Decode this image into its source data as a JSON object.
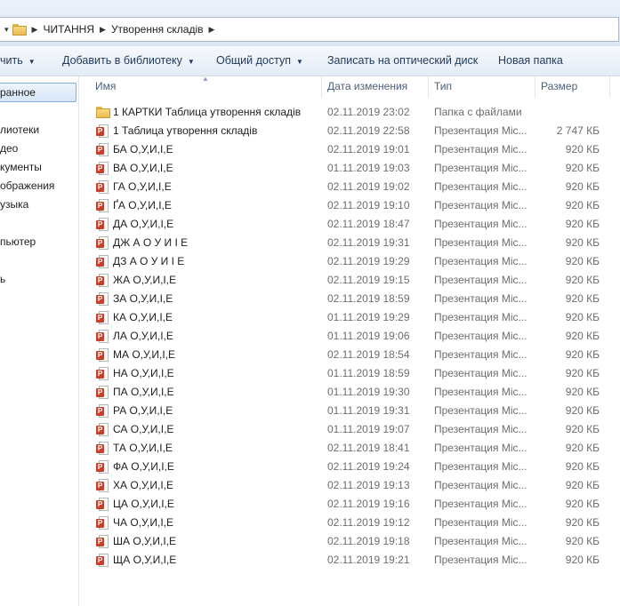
{
  "address": {
    "crumbs": [
      "ЧИТАННЯ",
      "Утворення складів"
    ]
  },
  "toolbar": {
    "organize_label": "чить",
    "library_label": "Добавить в библиотеку",
    "share_label": "Общий доступ",
    "burn_label": "Записать на оптический диск",
    "new_folder_label": "Новая папка"
  },
  "nav": {
    "favorites": "ранное",
    "libraries": "лиотеки",
    "video": "део",
    "documents": "кументы",
    "images": "ображения",
    "music": "узыка",
    "computer": "пьютер",
    "network": "ь"
  },
  "columns": {
    "name": "Имя",
    "date": "Дата изменения",
    "type": "Тип",
    "size": "Размер"
  },
  "files": [
    {
      "icon": "folder-icon",
      "name": "1 КАРТКИ Таблица утворення складів",
      "date": "02.11.2019 23:02",
      "type": "Папка с файлами",
      "size": ""
    },
    {
      "icon": "powerpoint-icon",
      "name": "1 Таблица утворення складів",
      "date": "02.11.2019 22:58",
      "type": "Презентация Mic...",
      "size": "2 747 КБ"
    },
    {
      "icon": "powerpoint-icon",
      "name": "БА О,У,И,І,Е",
      "date": "02.11.2019 19:01",
      "type": "Презентация Mic...",
      "size": "920 КБ"
    },
    {
      "icon": "powerpoint-icon",
      "name": "ВА О,У,И,І,Е",
      "date": "01.11.2019 19:03",
      "type": "Презентация Mic...",
      "size": "920 КБ"
    },
    {
      "icon": "powerpoint-icon",
      "name": "ГА О,У,И,І,Е",
      "date": "02.11.2019 19:02",
      "type": "Презентация Mic...",
      "size": "920 КБ"
    },
    {
      "icon": "powerpoint-icon",
      "name": "ҐА О,У,И,І,Е",
      "date": "02.11.2019 19:10",
      "type": "Презентация Mic...",
      "size": "920 КБ"
    },
    {
      "icon": "powerpoint-icon",
      "name": "ДА О,У,И,І,Е",
      "date": "02.11.2019 18:47",
      "type": "Презентация Mic...",
      "size": "920 КБ"
    },
    {
      "icon": "powerpoint-icon",
      "name": "ДЖ А О У И І Е",
      "date": "02.11.2019 19:31",
      "type": "Презентация Mic...",
      "size": "920 КБ"
    },
    {
      "icon": "powerpoint-icon",
      "name": "ДЗ А О У И І Е",
      "date": "02.11.2019 19:29",
      "type": "Презентация Mic...",
      "size": "920 КБ"
    },
    {
      "icon": "powerpoint-icon",
      "name": "ЖА О,У,И,І,Е",
      "date": "02.11.2019 19:15",
      "type": "Презентация Mic...",
      "size": "920 КБ"
    },
    {
      "icon": "powerpoint-icon",
      "name": "ЗА О,У,И,І,Е",
      "date": "02.11.2019 18:59",
      "type": "Презентация Mic...",
      "size": "920 КБ"
    },
    {
      "icon": "powerpoint-icon",
      "name": "КА О,У,И,І,Е",
      "date": "01.11.2019 19:29",
      "type": "Презентация Mic...",
      "size": "920 КБ"
    },
    {
      "icon": "powerpoint-icon",
      "name": "ЛА О,У,И,І,Е",
      "date": "01.11.2019 19:06",
      "type": "Презентация Mic...",
      "size": "920 КБ"
    },
    {
      "icon": "powerpoint-icon",
      "name": "МА О,У,И,І,Е",
      "date": "02.11.2019 18:54",
      "type": "Презентация Mic...",
      "size": "920 КБ"
    },
    {
      "icon": "powerpoint-icon",
      "name": "НА О,У,И,І,Е",
      "date": "01.11.2019 18:59",
      "type": "Презентация Mic...",
      "size": "920 КБ"
    },
    {
      "icon": "powerpoint-icon",
      "name": "ПА О,У,И,І,Е",
      "date": "01.11.2019 19:30",
      "type": "Презентация Mic...",
      "size": "920 КБ"
    },
    {
      "icon": "powerpoint-icon",
      "name": "РА О,У,И,І,Е",
      "date": "01.11.2019 19:31",
      "type": "Презентация Mic...",
      "size": "920 КБ"
    },
    {
      "icon": "powerpoint-icon",
      "name": "СА О,У,И,І,Е",
      "date": "01.11.2019 19:07",
      "type": "Презентация Mic...",
      "size": "920 КБ"
    },
    {
      "icon": "powerpoint-icon",
      "name": "ТА О,У,И,І,Е",
      "date": "02.11.2019 18:41",
      "type": "Презентация Mic...",
      "size": "920 КБ"
    },
    {
      "icon": "powerpoint-icon",
      "name": "ФА О,У,И,І,Е",
      "date": "02.11.2019 19:24",
      "type": "Презентация Mic...",
      "size": "920 КБ"
    },
    {
      "icon": "powerpoint-icon",
      "name": "ХА О,У,И,І,Е",
      "date": "02.11.2019 19:13",
      "type": "Презентация Mic...",
      "size": "920 КБ"
    },
    {
      "icon": "powerpoint-icon",
      "name": "ЦА О,У,И,І,Е",
      "date": "02.11.2019 19:16",
      "type": "Презентация Mic...",
      "size": "920 КБ"
    },
    {
      "icon": "powerpoint-icon",
      "name": "ЧА О,У,И,І,Е",
      "date": "02.11.2019 19:12",
      "type": "Презентация Mic...",
      "size": "920 КБ"
    },
    {
      "icon": "powerpoint-icon",
      "name": "ША О,У,И,І,Е",
      "date": "02.11.2019 19:18",
      "type": "Презентация Mic...",
      "size": "920 КБ"
    },
    {
      "icon": "powerpoint-icon",
      "name": "ЩА О,У,И,І,Е",
      "date": "02.11.2019 19:21",
      "type": "Презентация Mic...",
      "size": "920 КБ"
    }
  ]
}
